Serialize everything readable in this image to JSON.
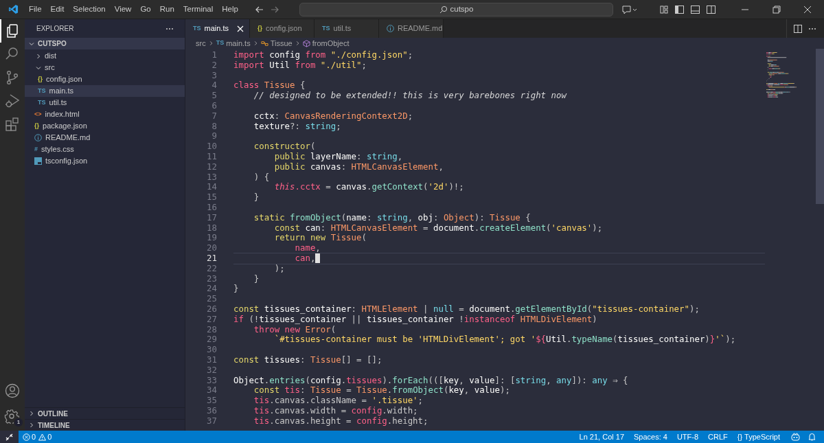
{
  "title_bar": {
    "menu": [
      "File",
      "Edit",
      "Selection",
      "View",
      "Go",
      "Run",
      "Terminal",
      "Help"
    ],
    "search": "cutspo"
  },
  "activity_bar": {
    "items": [
      {
        "kind": "explorer",
        "selected": true
      },
      {
        "kind": "search",
        "selected": false
      },
      {
        "kind": "source-control",
        "selected": false
      },
      {
        "kind": "run-debug",
        "selected": false
      },
      {
        "kind": "extensions",
        "selected": false
      }
    ],
    "settings_badge": "1"
  },
  "sidebar": {
    "title": "EXPLORER",
    "folder": "CUTSPO",
    "tree": [
      {
        "label": "dist",
        "kind": "folder",
        "expanded": false,
        "selected": false
      },
      {
        "label": "src",
        "kind": "folder",
        "expanded": true,
        "selected": false,
        "children": [
          {
            "label": "config.json",
            "kind": "json",
            "icon": "{}",
            "selected": false
          },
          {
            "label": "main.ts",
            "kind": "ts",
            "icon": "TS",
            "selected": true
          },
          {
            "label": "util.ts",
            "kind": "ts",
            "icon": "TS",
            "selected": false
          }
        ]
      },
      {
        "label": "index.html",
        "kind": "html",
        "icon": "<>",
        "selected": false
      },
      {
        "label": "package.json",
        "kind": "json",
        "icon": "{}",
        "selected": false
      },
      {
        "label": "README.md",
        "kind": "info",
        "selected": false
      },
      {
        "label": "styles.css",
        "kind": "css",
        "icon": "#",
        "selected": false
      },
      {
        "label": "tsconfig.json",
        "kind": "tsconfig",
        "selected": false
      }
    ],
    "panels": [
      "OUTLINE",
      "TIMELINE"
    ]
  },
  "tabs": [
    {
      "label": "main.ts",
      "kind": "ts",
      "icon": "TS",
      "selected": true
    },
    {
      "label": "config.json",
      "kind": "json",
      "icon": "{}",
      "selected": false
    },
    {
      "label": "util.ts",
      "kind": "ts",
      "icon": "TS",
      "selected": false
    },
    {
      "label": "README.md",
      "kind": "info",
      "selected": false
    }
  ],
  "breadcrumb": [
    {
      "label": "src",
      "kind": "folder"
    },
    {
      "label": "main.ts",
      "kind": "ts",
      "icon": "TS"
    },
    {
      "label": "Tissue",
      "kind": "class"
    },
    {
      "label": "fromObject",
      "kind": "method"
    }
  ],
  "editor": {
    "lines": [
      {
        "number": "1",
        "current": false,
        "tokens": [
          {
            "text": "import",
            "kind": "k"
          },
          {
            "text": " config ",
            "kind": "v"
          },
          {
            "text": "from",
            "kind": "k"
          },
          {
            "text": " \"./config.json\"",
            "kind": "s"
          },
          {
            "text": ";",
            "kind": "p"
          }
        ]
      },
      {
        "number": "2",
        "current": false,
        "tokens": [
          {
            "text": "import",
            "kind": "k"
          },
          {
            "text": " Util ",
            "kind": "v"
          },
          {
            "text": "from",
            "kind": "k"
          },
          {
            "text": " \"./util\"",
            "kind": "s"
          },
          {
            "text": ";",
            "kind": "p"
          }
        ]
      },
      {
        "number": "3",
        "current": false
      },
      {
        "number": "4",
        "current": false,
        "tokens": [
          {
            "text": "class",
            "kind": "k"
          },
          {
            "text": " Tissue",
            "kind": "t"
          },
          {
            "text": " {",
            "kind": "p"
          }
        ]
      },
      {
        "number": "5",
        "current": false,
        "tokens": [
          {
            "text": "    // designed to be extended!! this is very barebones right now",
            "kind": "c"
          }
        ]
      },
      {
        "number": "6",
        "current": false
      },
      {
        "number": "7",
        "current": false,
        "tokens": [
          {
            "text": "    cctx",
            "kind": "v"
          },
          {
            "text": ": ",
            "kind": "p"
          },
          {
            "text": "CanvasRenderingContext2D",
            "kind": "t"
          },
          {
            "text": ";",
            "kind": "p"
          }
        ]
      },
      {
        "number": "8",
        "current": false,
        "tokens": [
          {
            "text": "    texture",
            "kind": "v"
          },
          {
            "text": "?: ",
            "kind": "p"
          },
          {
            "text": "string",
            "kind": "b"
          },
          {
            "text": ";",
            "kind": "p"
          }
        ]
      },
      {
        "number": "9",
        "current": false
      },
      {
        "number": "10",
        "current": false,
        "tokens": [
          {
            "text": "    constructor",
            "kind": "y"
          },
          {
            "text": "(",
            "kind": "p"
          }
        ]
      },
      {
        "number": "11",
        "current": false,
        "tokens": [
          {
            "text": "        public",
            "kind": "y"
          },
          {
            "text": " layerName",
            "kind": "v"
          },
          {
            "text": ": ",
            "kind": "p"
          },
          {
            "text": "string",
            "kind": "b"
          },
          {
            "text": ",",
            "kind": "p"
          }
        ]
      },
      {
        "number": "12",
        "current": false,
        "tokens": [
          {
            "text": "        public",
            "kind": "y"
          },
          {
            "text": " canvas",
            "kind": "v"
          },
          {
            "text": ": ",
            "kind": "p"
          },
          {
            "text": "HTMLCanvasElement",
            "kind": "t"
          },
          {
            "text": ",",
            "kind": "p"
          }
        ]
      },
      {
        "number": "13",
        "current": false,
        "tokens": [
          {
            "text": "    ) {",
            "kind": "p"
          }
        ]
      },
      {
        "number": "14",
        "current": false,
        "tokens": [
          {
            "text": "        this",
            "kind": "i"
          },
          {
            "text": ".cctx",
            "kind": "r"
          },
          {
            "text": " = ",
            "kind": "p"
          },
          {
            "text": "canvas",
            "kind": "v"
          },
          {
            "text": ".",
            "kind": "p"
          },
          {
            "text": "getContext",
            "kind": "f"
          },
          {
            "text": "(",
            "kind": "p"
          },
          {
            "text": "'2d'",
            "kind": "s"
          },
          {
            "text": ")!;",
            "kind": "p"
          }
        ]
      },
      {
        "number": "15",
        "current": false,
        "tokens": [
          {
            "text": "    }",
            "kind": "p"
          }
        ]
      },
      {
        "number": "16",
        "current": false
      },
      {
        "number": "17",
        "current": false,
        "tokens": [
          {
            "text": "    static",
            "kind": "y"
          },
          {
            "text": " fromObject",
            "kind": "f"
          },
          {
            "text": "(",
            "kind": "p"
          },
          {
            "text": "name",
            "kind": "v"
          },
          {
            "text": ": ",
            "kind": "p"
          },
          {
            "text": "string",
            "kind": "b"
          },
          {
            "text": ", ",
            "kind": "p"
          },
          {
            "text": "obj",
            "kind": "v"
          },
          {
            "text": ": ",
            "kind": "p"
          },
          {
            "text": "Object",
            "kind": "t"
          },
          {
            "text": "): ",
            "kind": "p"
          },
          {
            "text": "Tissue",
            "kind": "t"
          },
          {
            "text": " {",
            "kind": "p"
          }
        ]
      },
      {
        "number": "18",
        "current": false,
        "tokens": [
          {
            "text": "        const",
            "kind": "y"
          },
          {
            "text": " can",
            "kind": "v"
          },
          {
            "text": ": ",
            "kind": "p"
          },
          {
            "text": "HTMLCanvasElement",
            "kind": "t"
          },
          {
            "text": " = ",
            "kind": "p"
          },
          {
            "text": "document",
            "kind": "v"
          },
          {
            "text": ".",
            "kind": "p"
          },
          {
            "text": "createElement",
            "kind": "f"
          },
          {
            "text": "(",
            "kind": "p"
          },
          {
            "text": "'canvas'",
            "kind": "s"
          },
          {
            "text": ");",
            "kind": "p"
          }
        ]
      },
      {
        "number": "19",
        "current": false,
        "tokens": [
          {
            "text": "        return new",
            "kind": "y"
          },
          {
            "text": " Tissue",
            "kind": "t"
          },
          {
            "text": "(",
            "kind": "p"
          }
        ]
      },
      {
        "number": "20",
        "current": false,
        "tokens": [
          {
            "text": "            name",
            "kind": "r"
          },
          {
            "text": ",",
            "kind": "p"
          }
        ]
      },
      {
        "number": "21",
        "current": true,
        "tokens": [
          {
            "text": "            can",
            "kind": "r"
          },
          {
            "text": ",",
            "kind": "p"
          }
        ]
      },
      {
        "number": "22",
        "current": false,
        "tokens": [
          {
            "text": "        );",
            "kind": "p"
          }
        ]
      },
      {
        "number": "23",
        "current": false,
        "tokens": [
          {
            "text": "    }",
            "kind": "p"
          }
        ]
      },
      {
        "number": "24",
        "current": false,
        "tokens": [
          {
            "text": "}",
            "kind": "p"
          }
        ]
      },
      {
        "number": "25",
        "current": false
      },
      {
        "number": "26",
        "current": false,
        "tokens": [
          {
            "text": "const",
            "kind": "y"
          },
          {
            "text": " tissues_container",
            "kind": "v"
          },
          {
            "text": ": ",
            "kind": "p"
          },
          {
            "text": "HTMLElement",
            "kind": "t"
          },
          {
            "text": " | ",
            "kind": "p"
          },
          {
            "text": "null",
            "kind": "b"
          },
          {
            "text": " = ",
            "kind": "p"
          },
          {
            "text": "document",
            "kind": "v"
          },
          {
            "text": ".",
            "kind": "p"
          },
          {
            "text": "getElementById",
            "kind": "f"
          },
          {
            "text": "(",
            "kind": "p"
          },
          {
            "text": "\"tissues-container\"",
            "kind": "s"
          },
          {
            "text": ");",
            "kind": "p"
          }
        ]
      },
      {
        "number": "27",
        "current": false,
        "tokens": [
          {
            "text": "if",
            "kind": "k"
          },
          {
            "text": " (!",
            "kind": "p"
          },
          {
            "text": "tissues_container",
            "kind": "v"
          },
          {
            "text": " || ",
            "kind": "p"
          },
          {
            "text": "tissues_container",
            "kind": "v"
          },
          {
            "text": " !",
            "kind": "p"
          },
          {
            "text": "instanceof",
            "kind": "k"
          },
          {
            "text": " HTMLDivElement",
            "kind": "t"
          },
          {
            "text": ")",
            "kind": "p"
          }
        ]
      },
      {
        "number": "28",
        "current": false,
        "tokens": [
          {
            "text": "    throw new",
            "kind": "k"
          },
          {
            "text": " Error",
            "kind": "t"
          },
          {
            "text": "(",
            "kind": "p"
          }
        ]
      },
      {
        "number": "29",
        "current": false,
        "tokens": [
          {
            "text": "        `#tissues-container must be 'HTMLDivElement'; got '",
            "kind": "s"
          },
          {
            "text": "${",
            "kind": "k"
          },
          {
            "text": "Util",
            "kind": "v"
          },
          {
            "text": ".",
            "kind": "p"
          },
          {
            "text": "typeName",
            "kind": "f"
          },
          {
            "text": "(",
            "kind": "p"
          },
          {
            "text": "tissues_container",
            "kind": "v"
          },
          {
            "text": ")",
            "kind": "p"
          },
          {
            "text": "}",
            "kind": "k"
          },
          {
            "text": "'`",
            "kind": "s"
          },
          {
            "text": ");",
            "kind": "p"
          }
        ]
      },
      {
        "number": "30",
        "current": false
      },
      {
        "number": "31",
        "current": false,
        "tokens": [
          {
            "text": "const",
            "kind": "y"
          },
          {
            "text": " tissues",
            "kind": "v"
          },
          {
            "text": ": ",
            "kind": "p"
          },
          {
            "text": "Tissue",
            "kind": "t"
          },
          {
            "text": "[] = [];",
            "kind": "p"
          }
        ]
      },
      {
        "number": "32",
        "current": false
      },
      {
        "number": "33",
        "current": false,
        "tokens": [
          {
            "text": "Object",
            "kind": "v"
          },
          {
            "text": ".",
            "kind": "p"
          },
          {
            "text": "entries",
            "kind": "f"
          },
          {
            "text": "(",
            "kind": "p"
          },
          {
            "text": "config",
            "kind": "v"
          },
          {
            "text": ".",
            "kind": "p"
          },
          {
            "text": "tissues",
            "kind": "r"
          },
          {
            "text": ").",
            "kind": "p"
          },
          {
            "text": "forEach",
            "kind": "f"
          },
          {
            "text": "(([",
            "kind": "p"
          },
          {
            "text": "key",
            "kind": "v"
          },
          {
            "text": ", ",
            "kind": "p"
          },
          {
            "text": "value",
            "kind": "v"
          },
          {
            "text": "]: [",
            "kind": "p"
          },
          {
            "text": "string",
            "kind": "b"
          },
          {
            "text": ", ",
            "kind": "p"
          },
          {
            "text": "any",
            "kind": "b"
          },
          {
            "text": "]): ",
            "kind": "p"
          },
          {
            "text": "any",
            "kind": "b"
          },
          {
            "text": " ⇒ {",
            "kind": "p"
          }
        ]
      },
      {
        "number": "34",
        "current": false,
        "tokens": [
          {
            "text": "    const",
            "kind": "y"
          },
          {
            "text": " tis",
            "kind": "r"
          },
          {
            "text": ": ",
            "kind": "p"
          },
          {
            "text": "Tissue",
            "kind": "t"
          },
          {
            "text": " = ",
            "kind": "p"
          },
          {
            "text": "Tissue",
            "kind": "t"
          },
          {
            "text": ".",
            "kind": "p"
          },
          {
            "text": "fromObject",
            "kind": "f"
          },
          {
            "text": "(",
            "kind": "p"
          },
          {
            "text": "key",
            "kind": "v"
          },
          {
            "text": ", ",
            "kind": "p"
          },
          {
            "text": "value",
            "kind": "v"
          },
          {
            "text": ");",
            "kind": "p"
          }
        ]
      },
      {
        "number": "35",
        "current": false,
        "tokens": [
          {
            "text": "    tis",
            "kind": "r"
          },
          {
            "text": ".canvas.className",
            "kind": "p"
          },
          {
            "text": " = ",
            "kind": "p"
          },
          {
            "text": "'.tissue'",
            "kind": "s"
          },
          {
            "text": ";",
            "kind": "p"
          }
        ]
      },
      {
        "number": "36",
        "current": false,
        "tokens": [
          {
            "text": "    tis",
            "kind": "r"
          },
          {
            "text": ".canvas.width",
            "kind": "p"
          },
          {
            "text": " = ",
            "kind": "p"
          },
          {
            "text": "config",
            "kind": "r"
          },
          {
            "text": ".width;",
            "kind": "p"
          }
        ]
      },
      {
        "number": "37",
        "current": false,
        "tokens": [
          {
            "text": "    tis",
            "kind": "r"
          },
          {
            "text": ".canvas.height",
            "kind": "p"
          },
          {
            "text": " = ",
            "kind": "p"
          },
          {
            "text": "config",
            "kind": "r"
          },
          {
            "text": ".height;",
            "kind": "p"
          }
        ]
      }
    ]
  },
  "status_bar": {
    "errors": "0",
    "warnings": "0",
    "items": [
      "Ln 21, Col 17",
      "Spaces: 4",
      "UTF-8",
      "CRLF",
      "{} TypeScript"
    ]
  }
}
